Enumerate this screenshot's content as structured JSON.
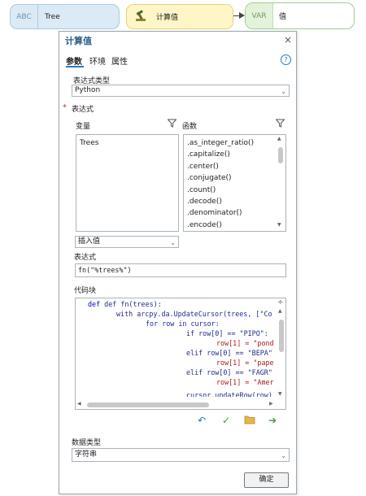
{
  "model": {
    "input_node": {
      "tag": "ABC",
      "label": "Tree"
    },
    "tool_node": {
      "label": "计算值"
    },
    "output_node": {
      "tag": "VAR",
      "label": "值"
    }
  },
  "dialog": {
    "title": "计算值",
    "close": "×",
    "tabs": [
      "参数",
      "环境",
      "属性"
    ],
    "help": "?",
    "expression_type_label": "表达式类型",
    "expression_type_value": "Python",
    "required_mark": "*",
    "expression_section_label": "表达式",
    "variables_header": "变量",
    "functions_header": "函数",
    "variables": [
      "Trees"
    ],
    "functions": [
      ".as_integer_ratio()",
      ".capitalize()",
      ".center()",
      ".conjugate()",
      ".count()",
      ".decode()",
      ".denominator()",
      ".encode()"
    ],
    "insert_value_label": "插入值",
    "expression_label": "表达式",
    "expression_value": "fn(\"%trees%\")",
    "code_block_label": "代码块",
    "code_lines": [
      "def fn(trees):",
      "with arcpy.da.UpdateCursor(trees, [\"Co",
      "for row in cursor:",
      "if row[0] == \"PIPO\":",
      "row[1] = \"pond",
      "elif row[0] == \"BEPA\"",
      "row[1] = \"pape",
      "elif row[0] == \"FAGR\"",
      "row[1] = \"Amer",
      "cursor.updateRow(row)"
    ],
    "data_type_label": "数据类型",
    "data_type_value": "字符串",
    "ok_button": "确定"
  },
  "colors": {
    "accent": "#2b78c5",
    "title": "#2b5f8c",
    "tool_node_bg": "#fff6c8",
    "data_node_bg": "#dbeaf5",
    "var_node_border": "#9ccf86"
  }
}
